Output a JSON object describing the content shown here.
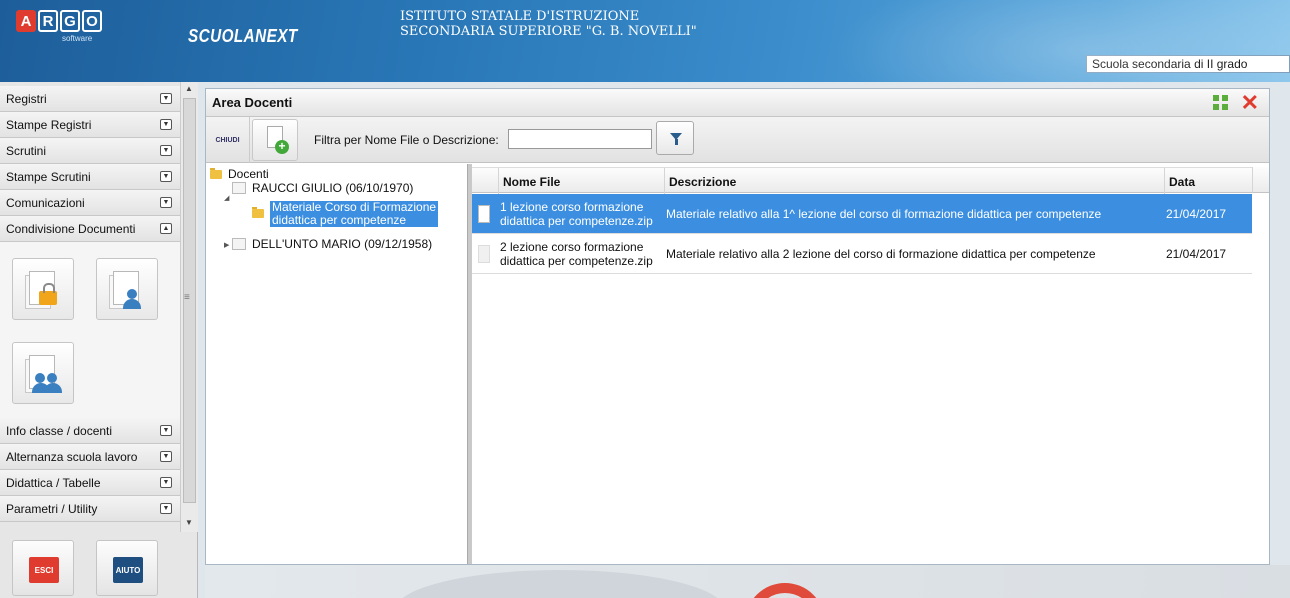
{
  "header": {
    "logo_letters": [
      "A",
      "R",
      "G",
      "O"
    ],
    "logo_sub": "software",
    "brand": "SCUOLANEXT",
    "institute_line1": "ISTITUTO STATALE D'ISTRUZIONE",
    "institute_line2": "SECONDARIA SUPERIORE \"G. B. NOVELLI\"",
    "school_level": "Scuola secondaria di II grado"
  },
  "sidebar": {
    "items_top": [
      {
        "label": "Registri"
      },
      {
        "label": "Stampe Registri"
      },
      {
        "label": "Scrutini"
      },
      {
        "label": "Stampe Scrutini"
      },
      {
        "label": "Comunicazioni"
      },
      {
        "label": "Condivisione Documenti"
      }
    ],
    "items_bottom": [
      {
        "label": "Info classe / docenti"
      },
      {
        "label": "Alternanza scuola lavoro"
      },
      {
        "label": "Didattica / Tabelle"
      },
      {
        "label": "Parametri / Utility"
      }
    ],
    "esci_label": "ESCI",
    "aiuto_label": "AIUTO",
    "icons": [
      "lock-document-icon",
      "user-document-icon",
      "group-document-icon"
    ]
  },
  "panel": {
    "title": "Area Docenti",
    "chiudi_label": "CHIUDI",
    "filter_label": "Filtra per Nome File o Descrizione:",
    "filter_value": "",
    "tree": {
      "root": "Docenti",
      "teacher1": "RAUCCI GIULIO (06/10/1970)",
      "folder_line1": "Materiale Corso di Formazione",
      "folder_line2": "didattica per competenze",
      "teacher2": "DELL'UNTO MARIO (09/12/1958)"
    },
    "grid": {
      "headers": [
        "Nome File",
        "Descrizione",
        "Data"
      ],
      "rows": [
        {
          "name_line1": "1 lezione corso formazione",
          "name_line2": "didattica per competenze.zip",
          "description": "Materiale relativo alla 1^ lezione del corso di formazione didattica per competenze",
          "date": "21/04/2017"
        },
        {
          "name_line1": "2 lezione corso formazione",
          "name_line2": "didattica per competenze.zip",
          "description": "Materiale relativo alla 2 lezione del corso di formazione didattica per competenze",
          "date": "21/04/2017"
        }
      ]
    }
  },
  "colors": {
    "header_blue": "#2a78b8",
    "selection": "#3c8fe0",
    "close_red": "#e03b2f",
    "maximize_green": "#5cae3c"
  }
}
